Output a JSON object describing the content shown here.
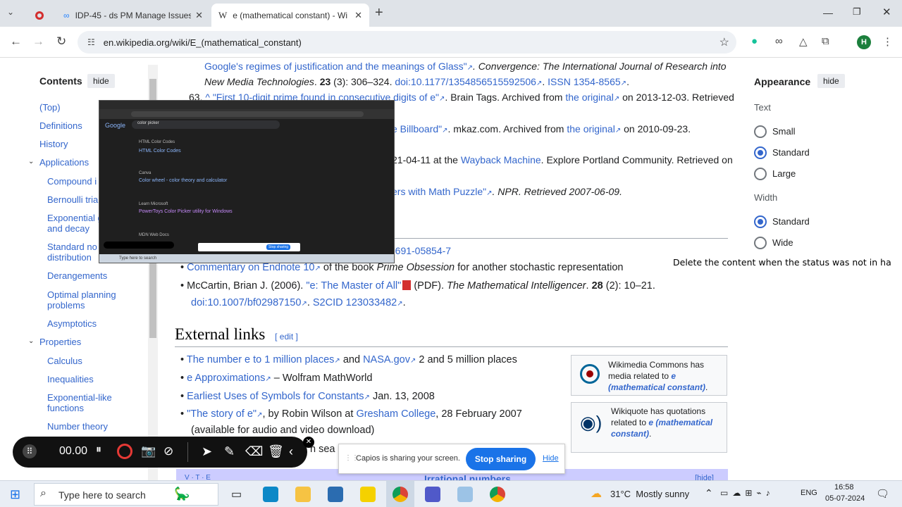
{
  "browser": {
    "tabs": [
      {
        "title": "",
        "icon": "record-icon"
      },
      {
        "title": "IDP-45 - ds PM Manage Issues",
        "icon": "jira-icon"
      },
      {
        "title": "e (mathematical constant) - Wi",
        "icon": "wikipedia-icon"
      }
    ],
    "new_tab": "+",
    "url": "en.wikipedia.org/wiki/E_(mathematical_constant)"
  },
  "toc": {
    "title": "Contents",
    "hide": "hide",
    "items": [
      "(Top)",
      "Definitions",
      "History",
      "Applications",
      "Compound i",
      "Bernoulli tria",
      "Exponential g",
      "and decay",
      "Standard no",
      "distribution",
      "Derangements",
      "Optimal planning",
      "problems",
      "Asymptotics",
      "Properties",
      "Calculus",
      "Inequalities",
      "Exponential-like",
      "functions",
      "Number theory"
    ]
  },
  "refs": {
    "r1_link": "Google's regimes of justification and the meanings of Glass\"",
    "r1_text": ". Convergence: The International Journal of Research into",
    "r2_italic": "New Media Technologies",
    "r2_vol": "23",
    "r2_pages": "(3): 306–324.",
    "r2_doi": "doi:10.1177/1354856515592506",
    "r2_issn": "ISSN 1354-8565",
    "r63_num": "63.",
    "r63_link": "^ \"First 10-digit prime found in consecutive digits of e\"",
    "r63_text": ". Brain Tags. Archived from",
    "r63_orig": "the original",
    "r63_date": "on 2013-12-03. Retrieved",
    "r64_link": "e Billboard\"",
    "r64_text": ". mkaz.com. Archived from",
    "r64_orig": "the original",
    "r64_date": "on 2010-09-23.",
    "r65_text": "21-04-11 at the",
    "r65_way": "Wayback Machine",
    "r65_rest": ". Explore Portland Community. Retrieved on",
    "r66_link": "ers with Math Puzzle\"",
    "r66_text": ". NPR. Retrieved 2007-06-09.",
    "isbn": "-691-05854-7"
  },
  "further": {
    "commentary_link": "Commentary on Endnote 10",
    "commentary_text": "of the book",
    "commentary_italic": "Prime Obsession",
    "commentary_rest": "for another stochastic representation",
    "mccartin_a": "McCartin, Brian J. (2006).",
    "mccartin_link": "\"e: The Master of All\"",
    "mccartin_pdf": "(PDF).",
    "mccartin_journal": "The Mathematical Intelligencer",
    "mccartin_vol": "28",
    "mccartin_pages": "(2): 10–21.",
    "mccartin_doi": "doi:10.1007/bf02987150",
    "mccartin_s2": "S2CID 123033482",
    "mccartin_end": "."
  },
  "external": {
    "heading": "External links",
    "edit": "[ edit ]",
    "l1_link": "The number e to 1 million places",
    "l1_and": "and",
    "l1_nasa": "NASA.gov",
    "l1_rest": "2 and 5 million places",
    "l2_link": "e Approximations",
    "l2_rest": "– Wolfram MathWorld",
    "l3_link": "Earliest Uses of Symbols for Constants",
    "l3_rest": "Jan. 13, 2008",
    "l4_link": "\"The story of e\"",
    "l4_by": ", by Robin Wilson at",
    "l4_college": "Gresham College",
    "l4_rest": ", 28 February 2007",
    "l4_line2": "(available for audio and video download)",
    "l5_partial": "n sea",
    "navbox_vte": "V · T · E",
    "navbox_title": "Irrational numbers",
    "navbox_hide": "[hide]"
  },
  "sidebox": {
    "commons_text": "Wikimedia Commons has media related to",
    "commons_link": "e (mathematical constant)",
    "commons_end": ".",
    "quote_text": "Wikiquote has quotations related to",
    "quote_link": "e (mathematical constant)",
    "quote_end": "."
  },
  "appearance": {
    "title": "Appearance",
    "hide": "hide",
    "text_label": "Text",
    "text_options": [
      "Small",
      "Standard",
      "Large"
    ],
    "text_selected": "Standard",
    "width_label": "Width",
    "width_options": [
      "Standard",
      "Wide"
    ],
    "width_selected": "Standard"
  },
  "floating_note": "Delete the content when the status was not in ha",
  "overlay": {
    "search_query": "color picker",
    "results": [
      {
        "site": "HTML Color Codes",
        "title": "HTML Color Codes"
      },
      {
        "site": "Canva",
        "title": "Color wheel - color theory and calculator"
      },
      {
        "site": "Learn Microsoft",
        "title": "PowerToys Color Picker utility for Windows"
      },
      {
        "site": "MDN Web Docs",
        "title": ""
      }
    ],
    "share_text": "Stop sharing",
    "taskbar_search": "Type here to search"
  },
  "recorder": {
    "timer": "00.00"
  },
  "share_bar": {
    "message": "Capios is sharing your screen.",
    "stop": "Stop sharing",
    "hide": "Hide"
  },
  "taskbar": {
    "search_placeholder": "Type here to search",
    "weather": "31°C  Mostly sunny",
    "lang": "ENG",
    "time": "16:58",
    "date": "05-07-2024"
  },
  "colors": {
    "link": "#3366cc",
    "accent": "#3366cc",
    "share_button": "#1a73e8"
  }
}
